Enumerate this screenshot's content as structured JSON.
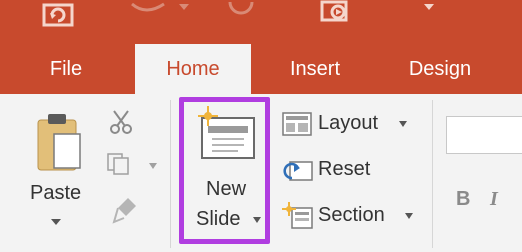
{
  "tabs": [
    {
      "label": "File"
    },
    {
      "label": "Home"
    },
    {
      "label": "Insert"
    },
    {
      "label": "Design"
    }
  ],
  "clipboard": {
    "paste_label": "Paste"
  },
  "slides": {
    "new_slide_line1": "New",
    "new_slide_line2": "Slide",
    "layout_label": "Layout",
    "reset_label": "Reset",
    "section_label": "Section"
  },
  "font": {
    "bold_label": "B",
    "italic_label": "I"
  },
  "colors": {
    "accent": "#c84a2d",
    "highlight": "#b03de0",
    "ribbon_bg": "#f3f3f3"
  }
}
